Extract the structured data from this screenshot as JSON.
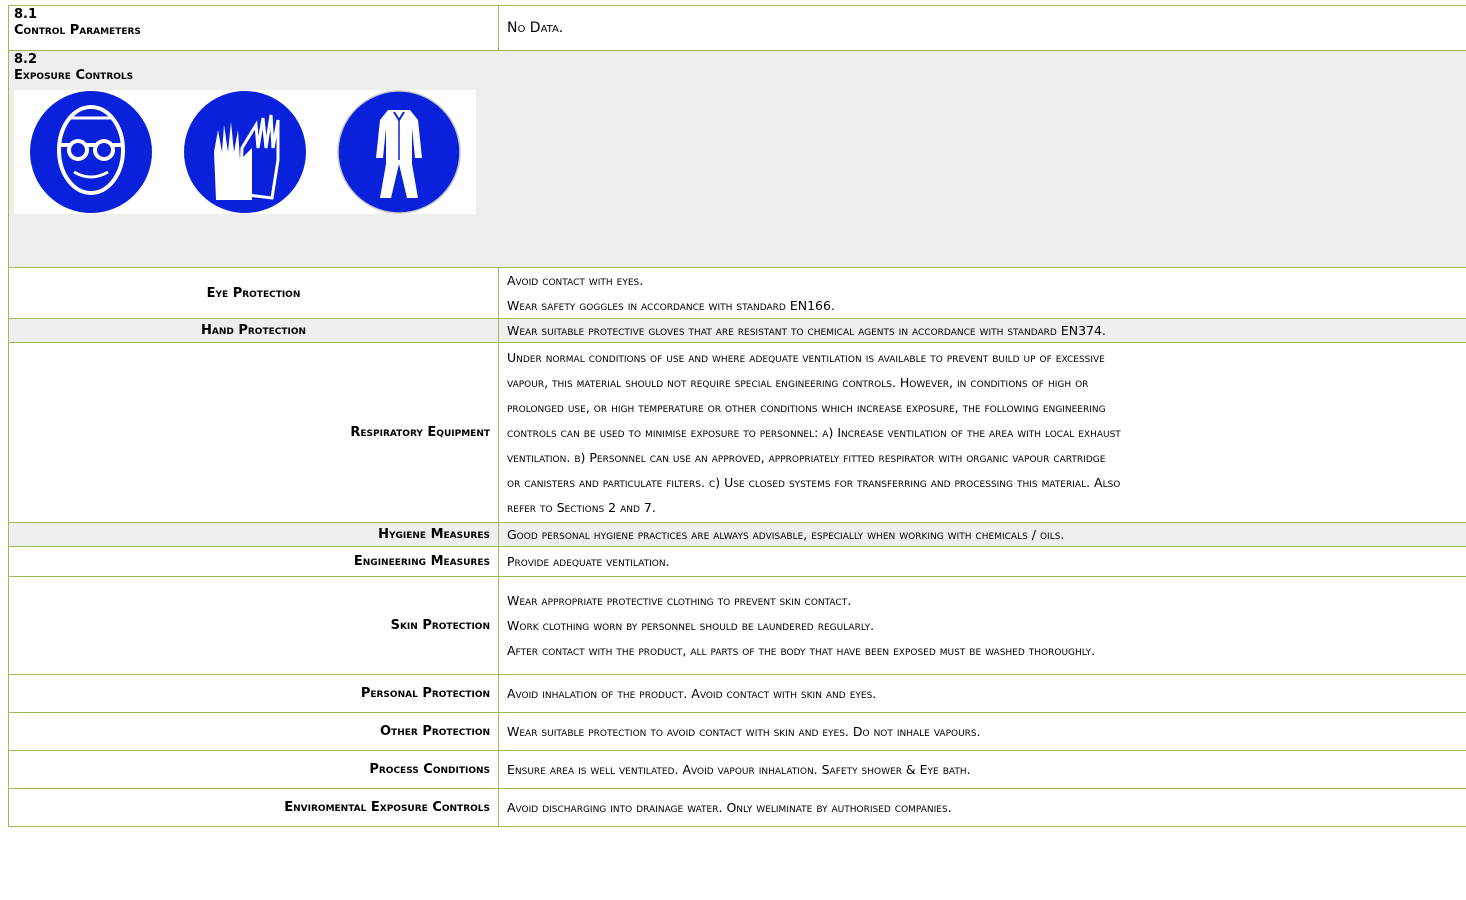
{
  "section_81": {
    "number": "8.1",
    "title": "Control Parameters",
    "value": "No Data."
  },
  "section_82": {
    "number": "8.2",
    "title": "Exposure Controls",
    "icons": [
      "goggles-mandatory-icon",
      "gloves-mandatory-icon",
      "protective-suit-mandatory-icon"
    ],
    "icon_color": "#0a21dc"
  },
  "rows": [
    {
      "label": "Eye Protection",
      "lines": [
        "Avoid contact with eyes.",
        "Wear safety goggles in accordance with standard EN166."
      ]
    },
    {
      "label": "Hand Protection",
      "lines": [
        "Wear suitable protective gloves that are resistant to chemical agents in accordance with standard EN374."
      ]
    },
    {
      "label": "Respiratory Equipment",
      "lines": [
        "Under normal conditions of use and where adequate ventilation is available to prevent build up of excessive",
        "vapour, this material should not require special engineering controls. However, in conditions of high or",
        "prolonged use, or high temperature or other conditions which increase exposure, the following engineering",
        "controls can be used to minimise exposure to personnel: a) Increase ventilation of the area with local exhaust",
        "ventilation. b) Personnel can use an approved, appropriately fitted respirator with organic vapour cartridge",
        "or canisters and particulate filters. c) Use closed systems for transferring and processing this material. Also",
        "refer to Sections 2 and 7."
      ]
    },
    {
      "label": "Hygiene Measures",
      "lines": [
        "Good personal hygiene practices are always advisable, especially when working with chemicals / oils."
      ]
    },
    {
      "label": "Engineering Measures",
      "lines": [
        "Provide adequate ventilation."
      ]
    },
    {
      "label": "Skin Protection",
      "lines": [
        "Wear appropriate protective clothing to prevent skin contact.",
        "Work clothing worn by personnel should be laundered regularly.",
        "After contact with the product, all parts of the body that have been exposed must be washed thoroughly."
      ]
    },
    {
      "label": "Personal Protection",
      "lines": [
        "Avoid inhalation of the product. Avoid contact with skin and eyes."
      ]
    },
    {
      "label": "Other Protection",
      "lines": [
        "Wear suitable protection to avoid contact with skin and eyes. Do not inhale vapours."
      ]
    },
    {
      "label": "Process Conditions",
      "lines": [
        "Ensure area is well ventilated. Avoid vapour inhalation. Safety shower & Eye bath."
      ]
    },
    {
      "label": "Enviromental Exposure Controls",
      "lines": [
        "Avoid discharging into drainage water. Only weliminate by authorised companies."
      ]
    }
  ]
}
